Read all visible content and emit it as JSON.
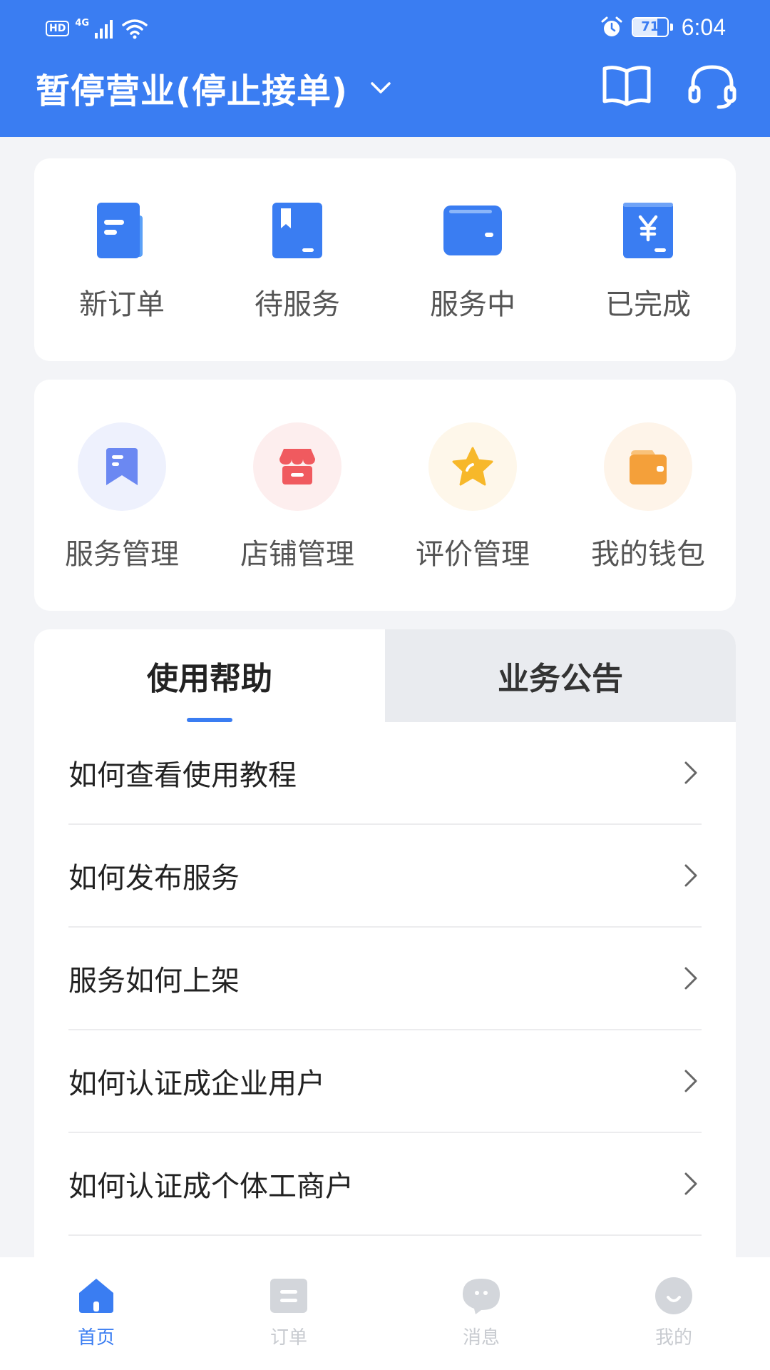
{
  "status_bar": {
    "hd": "HD",
    "network": "4G",
    "battery_percent": "71",
    "battery_level": 0.71,
    "time": "6:04"
  },
  "header": {
    "title": "暂停营业(停止接单)",
    "book_icon": "book-icon",
    "support_icon": "headset-icon"
  },
  "order_status": [
    {
      "label": "新订单",
      "icon": "document-icon"
    },
    {
      "label": "待服务",
      "icon": "bookmark-book-icon"
    },
    {
      "label": "服务中",
      "icon": "wallet-folder-icon"
    },
    {
      "label": "已完成",
      "icon": "yen-receipt-icon"
    }
  ],
  "management": [
    {
      "label": "服务管理",
      "icon": "bookmark-flag-icon",
      "color": "#6b88f2",
      "bg": "#eef1fd"
    },
    {
      "label": "店铺管理",
      "icon": "shop-icon",
      "color": "#f05a5f",
      "bg": "#fdeeee"
    },
    {
      "label": "评价管理",
      "icon": "star-icon",
      "color": "#f7b82a",
      "bg": "#fef7ea"
    },
    {
      "label": "我的钱包",
      "icon": "wallet-icon",
      "color": "#f4a03a",
      "bg": "#fef4e9"
    }
  ],
  "tabs": {
    "help": "使用帮助",
    "notice": "业务公告"
  },
  "help_items": [
    "如何查看使用教程",
    "如何发布服务",
    "服务如何上架",
    "如何认证成企业用户",
    "如何认证成个体工商户"
  ],
  "bottom_nav": [
    {
      "label": "首页",
      "icon": "home-icon"
    },
    {
      "label": "订单",
      "icon": "order-list-icon"
    },
    {
      "label": "消息",
      "icon": "message-icon"
    },
    {
      "label": "我的",
      "icon": "profile-icon"
    }
  ],
  "colors": {
    "primary": "#3a7df2",
    "inactive_nav": "#c8cbd0",
    "background": "#f3f4f7"
  }
}
